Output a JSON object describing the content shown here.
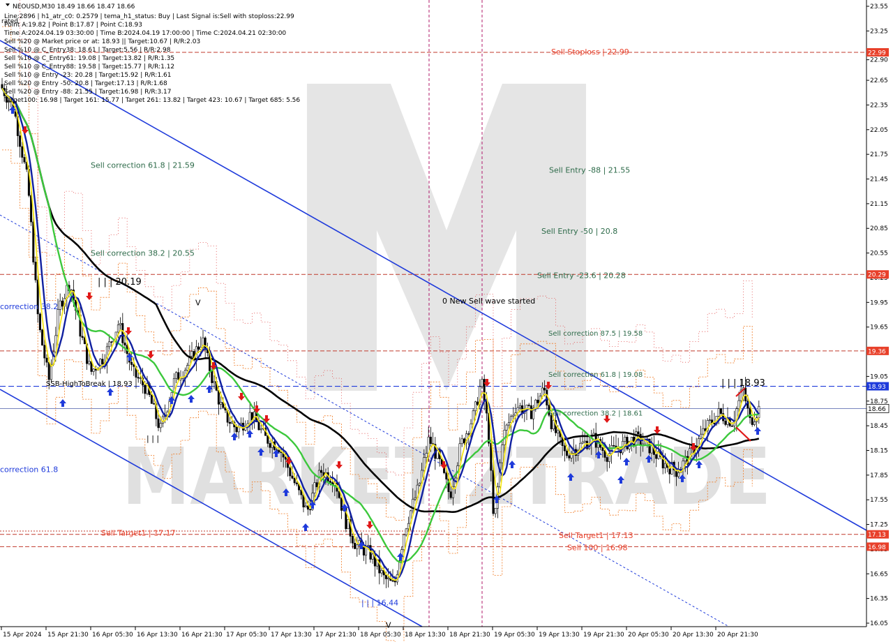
{
  "header": {
    "symbol_line": "NEOUSD,M30  18.49 18.66 18.47 18.66",
    "status_lines": [
      "Line:2896 | h1_atr_c0: 0.2579 | tema_h1_status: Buy | Last Signal is:Sell with stoploss:22.99",
      "Point A:19.82 | Point B:17.87 | Point C:18.93",
      "Time A:2024.04.19 03:30:00 | Time B:2024.04.19 17:00:00 | Time C:2024.04.21 02:30:00",
      "Sell %20 @ Market price or at: 18.93 || Target:10.67 | R/R:2.03",
      "Sell %10 @ C_Entry38: 18.61 | Target:5.56 | R/R:2.98",
      "Sell %10 @ C_Entry61: 19.08 | Target:13.82 | R/R:1.35",
      "Sell %10 @ C_Entry88: 19.58 | Target:15.77 | R/R:1.12",
      "Sell %10 @ Entry -23: 20.28 | Target:15.92 | R/R:1.61",
      "Sell %20 @ Entry -50: 20.8 | Target:17.13 | R/R:1.68",
      "Sell %20 @ Entry -88: 21.55 | Target:16.98 | R/R:3.17",
      "Target100: 16.98 | Target 161: 15.77 | Target 261: 13.82 | Target 423: 10.67 | Target 685: 5.56"
    ],
    "tag": "rated"
  },
  "watermark": {
    "text": "MARKETIZTRADE"
  },
  "chart_data": {
    "type": "candlestick",
    "symbol": "NEOUSD",
    "timeframe": "M30",
    "current_price": 18.66,
    "ylim": [
      16.05,
      23.55
    ],
    "y_ticks": [
      23.55,
      23.25,
      22.9,
      22.65,
      22.35,
      22.05,
      21.75,
      21.45,
      21.15,
      20.85,
      20.55,
      20.25,
      19.95,
      19.65,
      19.35,
      19.05,
      18.75,
      18.45,
      18.15,
      17.85,
      17.55,
      17.25,
      16.95,
      16.65,
      16.35,
      16.05
    ],
    "x_labels": [
      "15 Apr 2024",
      "15 Apr 21:30",
      "16 Apr 05:30",
      "16 Apr 13:30",
      "16 Apr 21:30",
      "17 Apr 05:30",
      "17 Apr 13:30",
      "17 Apr 21:30",
      "18 Apr 05:30",
      "18 Apr 13:30",
      "18 Apr 21:30",
      "19 Apr 05:30",
      "19 Apr 13:30",
      "19 Apr 21:30",
      "20 Apr 05:30",
      "20 Apr 13:30",
      "20 Apr 21:30"
    ],
    "price_tags": [
      {
        "value": 22.99,
        "label": "22.99",
        "color": "#e8402a"
      },
      {
        "value": 20.29,
        "label": "20.29",
        "color": "#e8402a"
      },
      {
        "value": 19.36,
        "label": "19.36",
        "color": "#e8402a"
      },
      {
        "value": 18.93,
        "label": "18.93",
        "color": "#1f3bdb"
      },
      {
        "value": 18.66,
        "label": "18.66",
        "color": "#ffffff"
      },
      {
        "value": 17.13,
        "label": "17.13",
        "color": "#e8402a"
      },
      {
        "value": 16.98,
        "label": "16.98",
        "color": "#e8402a"
      }
    ],
    "annotations": [
      {
        "text": "Sell Stoploss | 22.99",
        "value": 23.0,
        "color": "#e8402a"
      },
      {
        "text": "Sell correction 61.8 | 21.59",
        "value": 21.62,
        "color": "#2e6b4a"
      },
      {
        "text": "Sell Entry -88 | 21.55",
        "value": 21.56,
        "color": "#2e6b4a"
      },
      {
        "text": "Sell Entry -50 | 20.8",
        "value": 20.82,
        "color": "#2e6b4a"
      },
      {
        "text": "Sell correction 38.2 | 20.55",
        "value": 20.55,
        "color": "#2e6b4a"
      },
      {
        "text": "| | | 20.19",
        "value": 20.2,
        "color": "#000000"
      },
      {
        "text": "Sell Entry -23.6 | 20.28",
        "value": 20.28,
        "color": "#2e6b4a"
      },
      {
        "text": "0 New Sell wave started",
        "value": 19.97,
        "color": "#000000"
      },
      {
        "text": "correction 38.2",
        "value": 19.9,
        "color": "#1f3bdb"
      },
      {
        "text": "Sell correction 87.5 | 19.58",
        "value": 19.58,
        "color": "#2e6b4a"
      },
      {
        "text": "Sell correction 61.8 | 19.08",
        "value": 19.08,
        "color": "#2e6b4a"
      },
      {
        "text": "| | | 18.93",
        "value": 18.97,
        "color": "#000000"
      },
      {
        "text": "SSB-HighToBreak | 18.93",
        "value": 18.97,
        "color": "#000000"
      },
      {
        "text": "Sell correction 38.2 | 18.61",
        "value": 18.61,
        "color": "#2e6b4a"
      },
      {
        "text": "| | |",
        "value": 18.3,
        "color": "#000000"
      },
      {
        "text": "correction 61.8",
        "value": 17.92,
        "color": "#1f3bdb"
      },
      {
        "text": "Sell Target1 | 17.17",
        "value": 17.15,
        "color": "#e8402a"
      },
      {
        "text": "Sell Target1 | 17.13",
        "value": 17.12,
        "color": "#e8402a"
      },
      {
        "text": "Sell 100 | 16.98",
        "value": 16.97,
        "color": "#e8402a"
      },
      {
        "text": "| | | 16.44",
        "value": 16.3,
        "color": "#1f3bdb"
      },
      {
        "text": "V",
        "value": 16.03,
        "color": "#000000"
      },
      {
        "text": "V",
        "value": 19.95,
        "color": "#000000"
      }
    ],
    "series": [
      {
        "name": "",
        "color": "#000000"
      },
      {
        "name": "",
        "color": "#1020a0"
      },
      {
        "name": "",
        "color": "#f5e619"
      },
      {
        "name": "",
        "color": "#3cc83c"
      }
    ]
  }
}
